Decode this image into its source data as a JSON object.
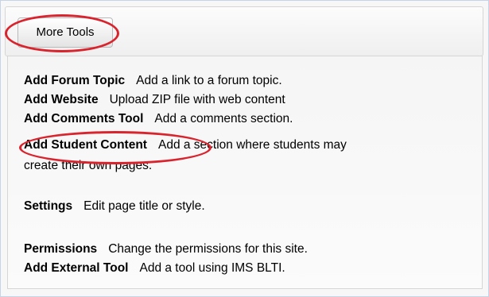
{
  "toolbar": {
    "more_tools_label": "More Tools"
  },
  "menu": {
    "items": [
      {
        "name": "Add Forum Topic",
        "description": "Add a link to a forum topic."
      },
      {
        "name": "Add Website",
        "description": "Upload ZIP file with web content"
      },
      {
        "name": "Add Comments Tool",
        "description": "Add a comments section."
      },
      {
        "name": "Add Student Content",
        "description": "Add a section where students may",
        "continuation": "create their own pages."
      },
      {
        "name": "Settings",
        "description": "Edit page title or style."
      },
      {
        "name": "Permissions",
        "description": "Change the permissions for this site."
      },
      {
        "name": "Add External Tool",
        "description": "Add a tool using IMS BLTI."
      }
    ]
  },
  "annotations": {
    "highlight_color": "#d9232d"
  }
}
